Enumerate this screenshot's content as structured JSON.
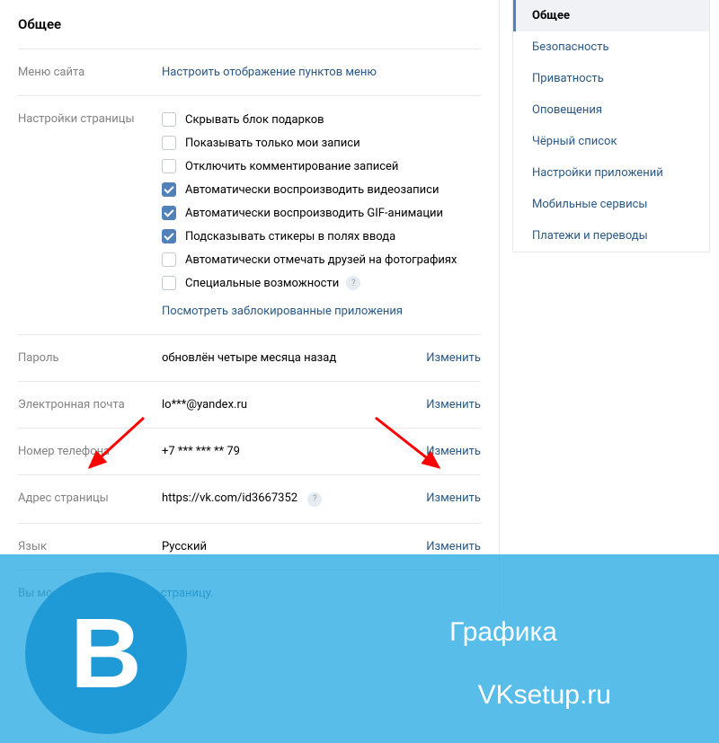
{
  "page_title": "Общее",
  "sidebar": {
    "items": [
      {
        "label": "Общее",
        "active": true
      },
      {
        "label": "Безопасность",
        "active": false
      },
      {
        "label": "Приватность",
        "active": false
      },
      {
        "label": "Оповещения",
        "active": false
      },
      {
        "label": "Чёрный список",
        "active": false
      },
      {
        "label": "Настройки приложений",
        "active": false
      },
      {
        "label": "Мобильные сервисы",
        "active": false
      },
      {
        "label": "Платежи и переводы",
        "active": false
      }
    ]
  },
  "menu_section": {
    "label": "Меню сайта",
    "link": "Настроить отображение пунктов меню"
  },
  "page_settings": {
    "label": "Настройки страницы",
    "checkboxes": [
      {
        "label": "Скрывать блок подарков",
        "checked": false
      },
      {
        "label": "Показывать только мои записи",
        "checked": false
      },
      {
        "label": "Отключить комментирование записей",
        "checked": false
      },
      {
        "label": "Автоматически воспроизводить видеозаписи",
        "checked": true
      },
      {
        "label": "Автоматически воспроизводить GIF-анимации",
        "checked": true
      },
      {
        "label": "Подсказывать стикеры в полях ввода",
        "checked": true
      },
      {
        "label": "Автоматически отмечать друзей на фотографиях",
        "checked": false
      },
      {
        "label": "Специальные возможности",
        "checked": false,
        "help": true
      }
    ],
    "blocked_link": "Посмотреть заблокированные приложения"
  },
  "rows": {
    "password": {
      "label": "Пароль",
      "value": "обновлён четыре месяца назад",
      "action": "Изменить"
    },
    "email": {
      "label": "Электронная почта",
      "value": "lo***@yandex.ru",
      "action": "Изменить"
    },
    "phone": {
      "label": "Номер телефона",
      "value": "+7 *** *** ** 79",
      "action": "Изменить"
    },
    "address": {
      "label": "Адрес страницы",
      "value": "https://vk.com/id3667352",
      "action": "Изменить",
      "help": true
    },
    "language": {
      "label": "Язык",
      "value": "Русский",
      "action": "Изменить"
    }
  },
  "delete": {
    "prefix": "Вы можете ",
    "link": "удалить свою страницу."
  },
  "overlay": {
    "logo_letter": "B",
    "text1": "Графика",
    "text2": "VKsetup.ru"
  },
  "help_glyph": "?"
}
